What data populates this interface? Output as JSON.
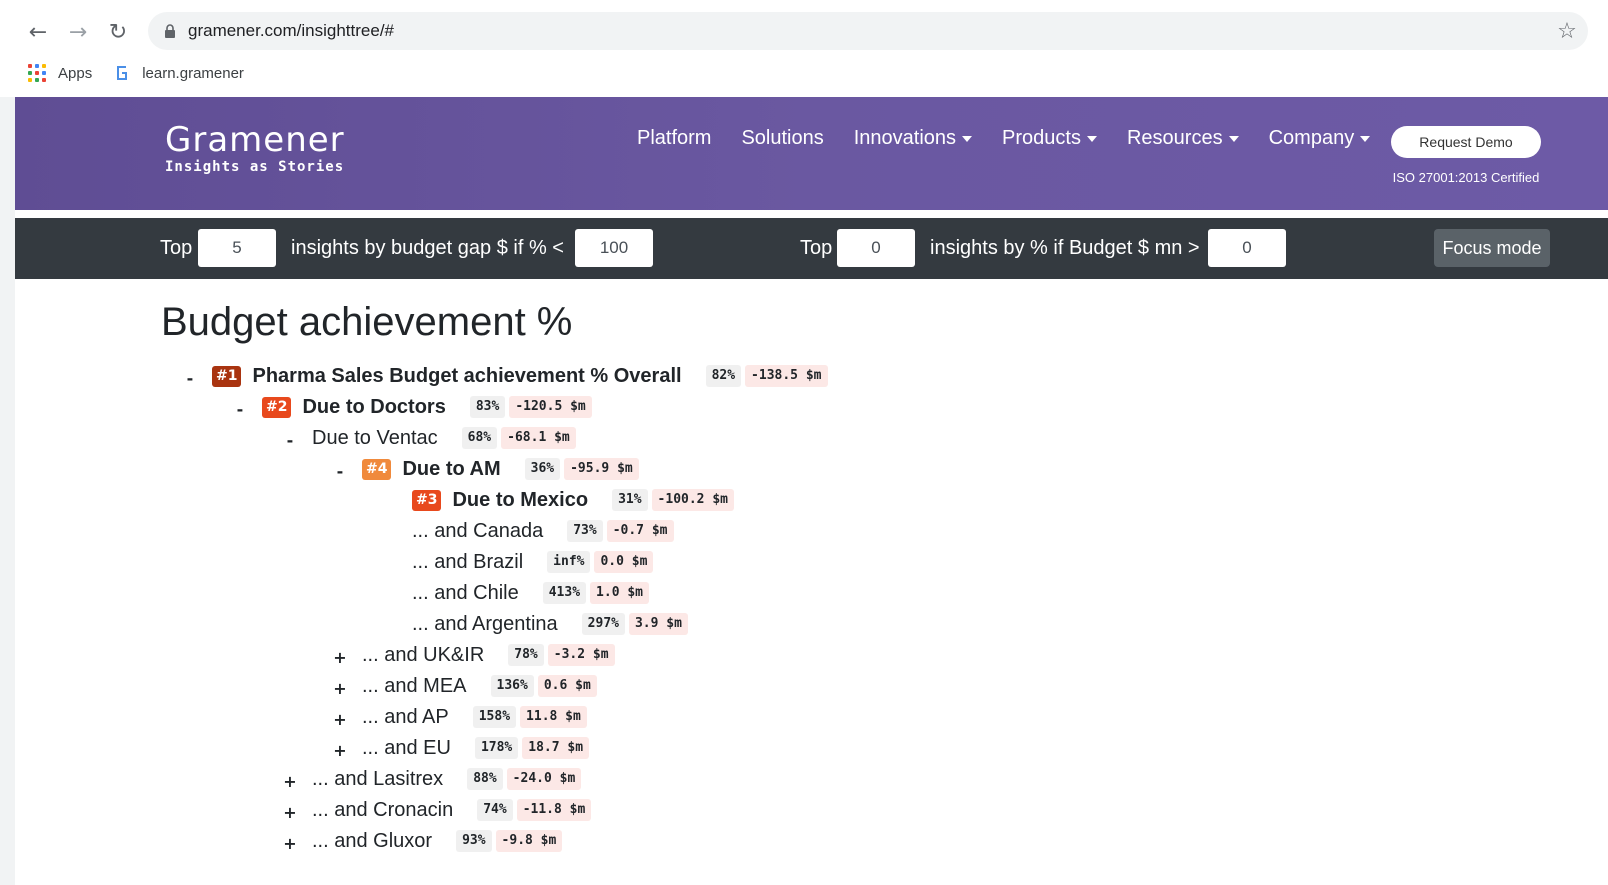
{
  "browser": {
    "url": "gramener.com/insighttree/#",
    "bookmarks": [
      {
        "label": "Apps",
        "icon": "apps-grid-icon"
      },
      {
        "label": "learn.gramener",
        "icon": "gramener-g-icon"
      }
    ]
  },
  "header": {
    "logo_name": "Gramener",
    "logo_tagline": "Insights as Stories",
    "menu": [
      {
        "label": "Platform",
        "dropdown": false
      },
      {
        "label": "Solutions",
        "dropdown": false
      },
      {
        "label": "Innovations",
        "dropdown": true
      },
      {
        "label": "Products",
        "dropdown": true
      },
      {
        "label": "Resources",
        "dropdown": true
      },
      {
        "label": "Company",
        "dropdown": true
      }
    ],
    "demo_button": "Request Demo",
    "iso_note": "ISO 27001:2013 Certified"
  },
  "toolbar": {
    "top_label_1": "Top",
    "top_value_1": "5",
    "text_1": "insights by budget gap $ if % <",
    "threshold_1": "100",
    "top_label_2": "Top",
    "top_value_2": "0",
    "text_2": "insights by % if Budget $ mn >",
    "threshold_2": "0",
    "focus_button": "Focus mode"
  },
  "content": {
    "title": "Budget achievement %",
    "rows": [
      {
        "toggle": "-",
        "rank": "#1",
        "label": "Pharma Sales Budget achievement % Overall",
        "bold": true,
        "pct": "82%",
        "gap": "-138.5 $m"
      },
      {
        "toggle": "-",
        "rank": "#2",
        "label": "Due to Doctors",
        "bold": true,
        "pct": "83%",
        "gap": "-120.5 $m"
      },
      {
        "toggle": "-",
        "rank": "",
        "label": "Due to Ventac",
        "bold": false,
        "pct": "68%",
        "gap": "-68.1 $m"
      },
      {
        "toggle": "-",
        "rank": "#4",
        "label": "Due to AM",
        "bold": true,
        "pct": "36%",
        "gap": "-95.9 $m"
      },
      {
        "toggle": "",
        "rank": "#3",
        "label": "Due to Mexico",
        "bold": true,
        "pct": "31%",
        "gap": "-100.2 $m"
      },
      {
        "toggle": "",
        "rank": "",
        "label": "... and Canada",
        "bold": false,
        "pct": "73%",
        "gap": "-0.7 $m"
      },
      {
        "toggle": "",
        "rank": "",
        "label": "... and Brazil",
        "bold": false,
        "pct": "inf%",
        "gap": "0.0 $m"
      },
      {
        "toggle": "",
        "rank": "",
        "label": "... and Chile",
        "bold": false,
        "pct": "413%",
        "gap": "1.0 $m"
      },
      {
        "toggle": "",
        "rank": "",
        "label": "... and Argentina",
        "bold": false,
        "pct": "297%",
        "gap": "3.9 $m"
      },
      {
        "toggle": "+",
        "rank": "",
        "label": "... and UK&IR",
        "bold": false,
        "pct": "78%",
        "gap": "-3.2 $m"
      },
      {
        "toggle": "+",
        "rank": "",
        "label": "... and MEA",
        "bold": false,
        "pct": "136%",
        "gap": "0.6 $m"
      },
      {
        "toggle": "+",
        "rank": "",
        "label": "... and AP",
        "bold": false,
        "pct": "158%",
        "gap": "11.8 $m"
      },
      {
        "toggle": "+",
        "rank": "",
        "label": "... and EU",
        "bold": false,
        "pct": "178%",
        "gap": "18.7 $m"
      },
      {
        "toggle": "+",
        "rank": "",
        "label": "... and Lasitrex",
        "bold": false,
        "pct": "88%",
        "gap": "-24.0 $m"
      },
      {
        "toggle": "+",
        "rank": "",
        "label": "... and Cronacin",
        "bold": false,
        "pct": "74%",
        "gap": "-11.8 $m"
      },
      {
        "toggle": "+",
        "rank": "",
        "label": "... and Gluxor",
        "bold": false,
        "pct": "93%",
        "gap": "-9.8 $m"
      }
    ]
  },
  "colors": {
    "header_purple": "#6a58a1",
    "toolbar_dark": "#343a40",
    "rank_1": "#a93410",
    "rank_2": "#e8491d",
    "rank_3": "#e8491d",
    "rank_4": "#f08a3c",
    "gap_tag_bg": "#fce8e6"
  }
}
